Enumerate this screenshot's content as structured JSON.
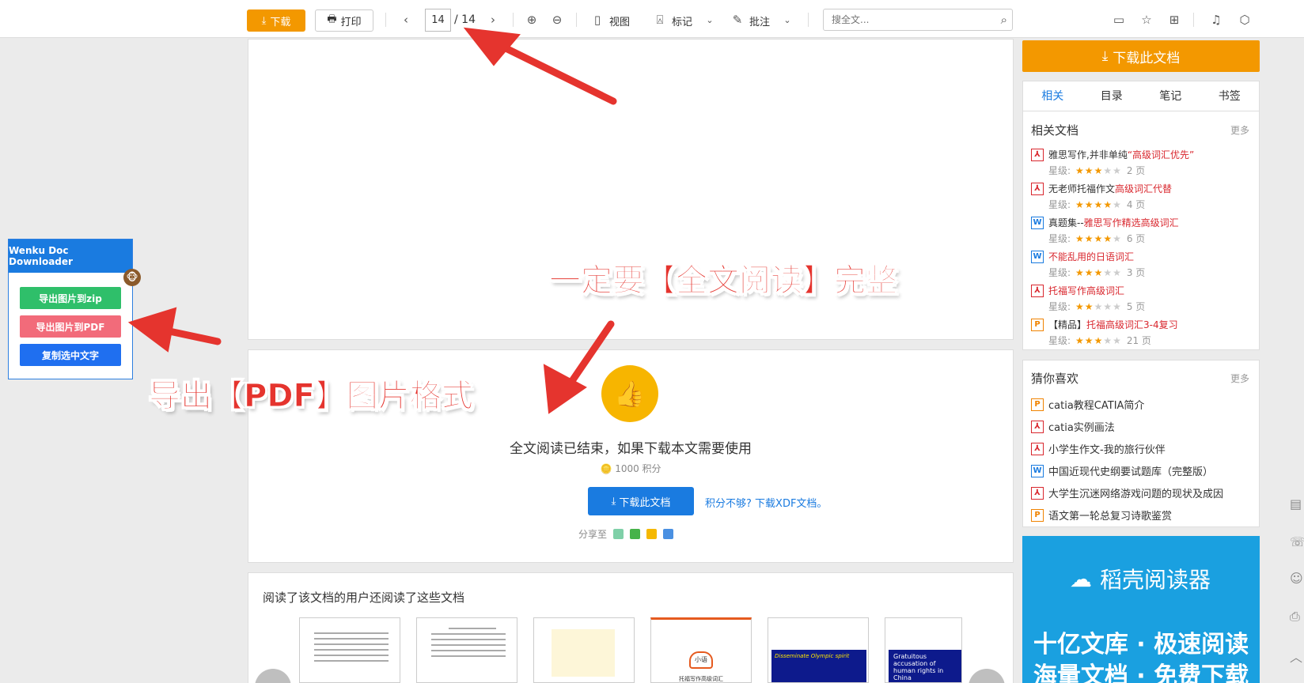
{
  "toolbar": {
    "download_label": "下载",
    "print_label": "打印",
    "page_current": "14",
    "page_total": "/ 14",
    "view_label": "视图",
    "mark_label": "标记",
    "annotate_label": "批注",
    "search_placeholder": "搜全文..."
  },
  "document": {
    "end_message": "全文阅读已结束，如果下载本文需要使用",
    "points": "1000 积分",
    "download_button": "下载此文档",
    "xdf_link": "积分不够? 下载XDF文档。",
    "share_label": "分享至",
    "recommend_title": "阅读了该文档的用户还阅读了这些文档",
    "thumb_texts": [
      "小语",
      "托福写作高级词汇",
      "Disseminate Olympic spirit",
      "Gratuitous accusation of human rights in China"
    ]
  },
  "sidebar": {
    "download_button": "下载此文档",
    "tabs": [
      "相关",
      "目录",
      "笔记",
      "书签"
    ],
    "related_title": "相关文档",
    "more_label": "更多",
    "rating_label": "星级:",
    "related": [
      {
        "type": "pdf",
        "prefix": "雅思写作,并非单纯",
        "highlight": "“高级词汇优先”",
        "stars": 3,
        "pages": "2 页"
      },
      {
        "type": "pdf",
        "prefix": "无老师托福作文 ",
        "highlight": "高级词汇代替",
        "stars": 4,
        "pages": "4 页"
      },
      {
        "type": "doc",
        "prefix": "真题集--",
        "highlight": "雅思写作精选高级词汇",
        "stars": 4,
        "pages": "6 页"
      },
      {
        "type": "doc",
        "prefix": "",
        "highlight": "不能乱用的日语词汇",
        "stars": 3,
        "pages": "3 页"
      },
      {
        "type": "pdf",
        "prefix": "",
        "highlight": "托福写作高级词汇",
        "stars": 2,
        "pages": "5 页"
      },
      {
        "type": "ppt",
        "prefix": "【精品】",
        "highlight": "托福高级词汇3-4复习",
        "stars": 3,
        "pages": "21 页"
      }
    ],
    "guess_title": "猜你喜欢",
    "guess": [
      {
        "type": "ppt",
        "name": "catia教程CATIA简介"
      },
      {
        "type": "pdf",
        "name": "catia实例画法"
      },
      {
        "type": "pdf",
        "name": "小学生作文-我的旅行伙伴"
      },
      {
        "type": "doc",
        "name": "中国近现代史纲要试题库（完整版）"
      },
      {
        "type": "pdf",
        "name": "大学生沉迷网络游戏问题的现状及成因"
      },
      {
        "type": "ppt",
        "name": "语文第一轮总复习诗歌鉴赏"
      }
    ],
    "ad": {
      "brand": "稻壳阅读器",
      "line1": "十亿文库 · 极速阅读",
      "line2": "海量文档 · 免费下载"
    }
  },
  "extension": {
    "title": "Wenku Doc Downloader",
    "btn_zip": "导出图片到zip",
    "btn_pdf": "导出图片到PDF",
    "btn_copy": "复制选中文字"
  },
  "annotations": {
    "read_full": "一定要【全文阅读】完整",
    "export_pdf": "导出【PDF】图片格式"
  },
  "colors": {
    "accent_orange": "#f39800",
    "link_blue": "#1a7be0",
    "highlight_red": "#d9272e",
    "annotation_red": "#e5342e",
    "ext_green": "#2fbf6a",
    "ext_pink": "#f26b7a",
    "ext_blue": "#1f6ff0"
  }
}
